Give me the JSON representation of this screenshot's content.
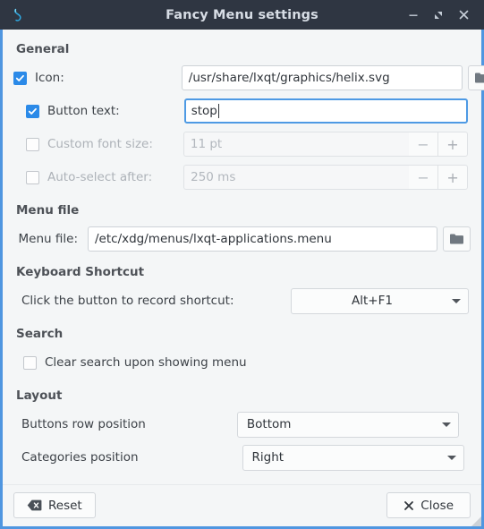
{
  "titlebar": {
    "app_icon": "helix-icon",
    "title": "Fancy Menu settings",
    "minimize": "minimize-icon",
    "maximize": "maximize-icon",
    "close": "close-icon"
  },
  "general": {
    "heading": "General",
    "icon_row": {
      "label": "Icon:",
      "checked": true,
      "value": "/usr/share/lxqt/graphics/helix.svg",
      "browse": "folder-icon"
    },
    "button_text_row": {
      "label": "Button text:",
      "checked": true,
      "value": "stop",
      "focused": true
    },
    "font_size_row": {
      "label": "Custom font size:",
      "checked": false,
      "value": "11 pt",
      "enabled": false,
      "minus": "−",
      "plus": "+"
    },
    "auto_select_row": {
      "label": "Auto-select after:",
      "checked": false,
      "value": "250 ms",
      "enabled": false,
      "minus": "−",
      "plus": "+"
    }
  },
  "menu_file": {
    "heading": "Menu file",
    "label": "Menu file:",
    "value": "/etc/xdg/menus/lxqt-applications.menu",
    "browse": "folder-icon"
  },
  "keyboard_shortcut": {
    "heading": "Keyboard Shortcut",
    "label": "Click the button to record shortcut:",
    "value": "Alt+F1"
  },
  "search": {
    "heading": "Search",
    "clear_label": "Clear search upon showing menu",
    "clear_checked": false
  },
  "layout": {
    "heading": "Layout",
    "buttons_row": {
      "label": "Buttons row position",
      "value": "Bottom"
    },
    "categories_row": {
      "label": "Categories position",
      "value": "Right"
    }
  },
  "footer": {
    "reset_label": "Reset",
    "reset_icon": "backspace-icon",
    "close_label": "Close",
    "close_icon": "close-x-icon"
  },
  "colors": {
    "titlebar_bg": "#2f3642",
    "window_border": "#4f96e0",
    "accent_checkbox": "#2b8ae8",
    "focus_border": "#4e9ae4",
    "content_bg": "#f4f6f7"
  }
}
